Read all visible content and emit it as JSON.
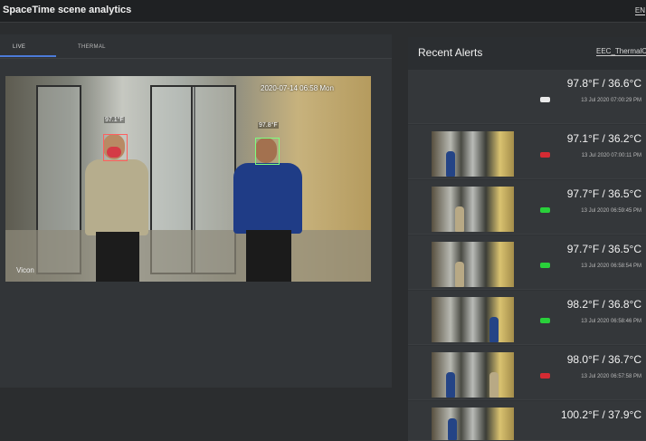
{
  "app": {
    "title": "SpaceTime scene analytics",
    "lang": "EN"
  },
  "tabs": [
    {
      "label": "LIVE"
    },
    {
      "label": "THERMAL"
    }
  ],
  "video": {
    "timestamp": "2020-07-14 06:58 Mon",
    "watermark": "Vicon",
    "tags": [
      {
        "text": "97.1°F"
      },
      {
        "text": "97.8°F"
      }
    ]
  },
  "alerts": {
    "title": "Recent Alerts",
    "select": "EEC_ThermalC",
    "items": [
      {
        "temp": "97.8°F / 36.6°C",
        "time": "13 Jul 2020 07:00:29 PM",
        "badge": "#eaeaea",
        "has_thumb": false
      },
      {
        "temp": "97.1°F / 36.2°C",
        "time": "13 Jul 2020 07:00:11 PM",
        "badge": "#d42b33",
        "has_thumb": true
      },
      {
        "temp": "97.7°F / 36.5°C",
        "time": "13 Jul 2020 06:59:45 PM",
        "badge": "#29d03a",
        "has_thumb": true
      },
      {
        "temp": "97.7°F / 36.5°C",
        "time": "13 Jul 2020 06:58:54 PM",
        "badge": "#29d03a",
        "has_thumb": true
      },
      {
        "temp": "98.2°F / 36.8°C",
        "time": "13 Jul 2020 06:58:46 PM",
        "badge": "#29d03a",
        "has_thumb": true
      },
      {
        "temp": "98.0°F / 36.7°C",
        "time": "13 Jul 2020 06:57:58 PM",
        "badge": "#d42b33",
        "has_thumb": true
      },
      {
        "temp": "100.2°F / 37.9°C",
        "time": "",
        "badge": "#29d03a",
        "has_thumb": true
      }
    ]
  }
}
